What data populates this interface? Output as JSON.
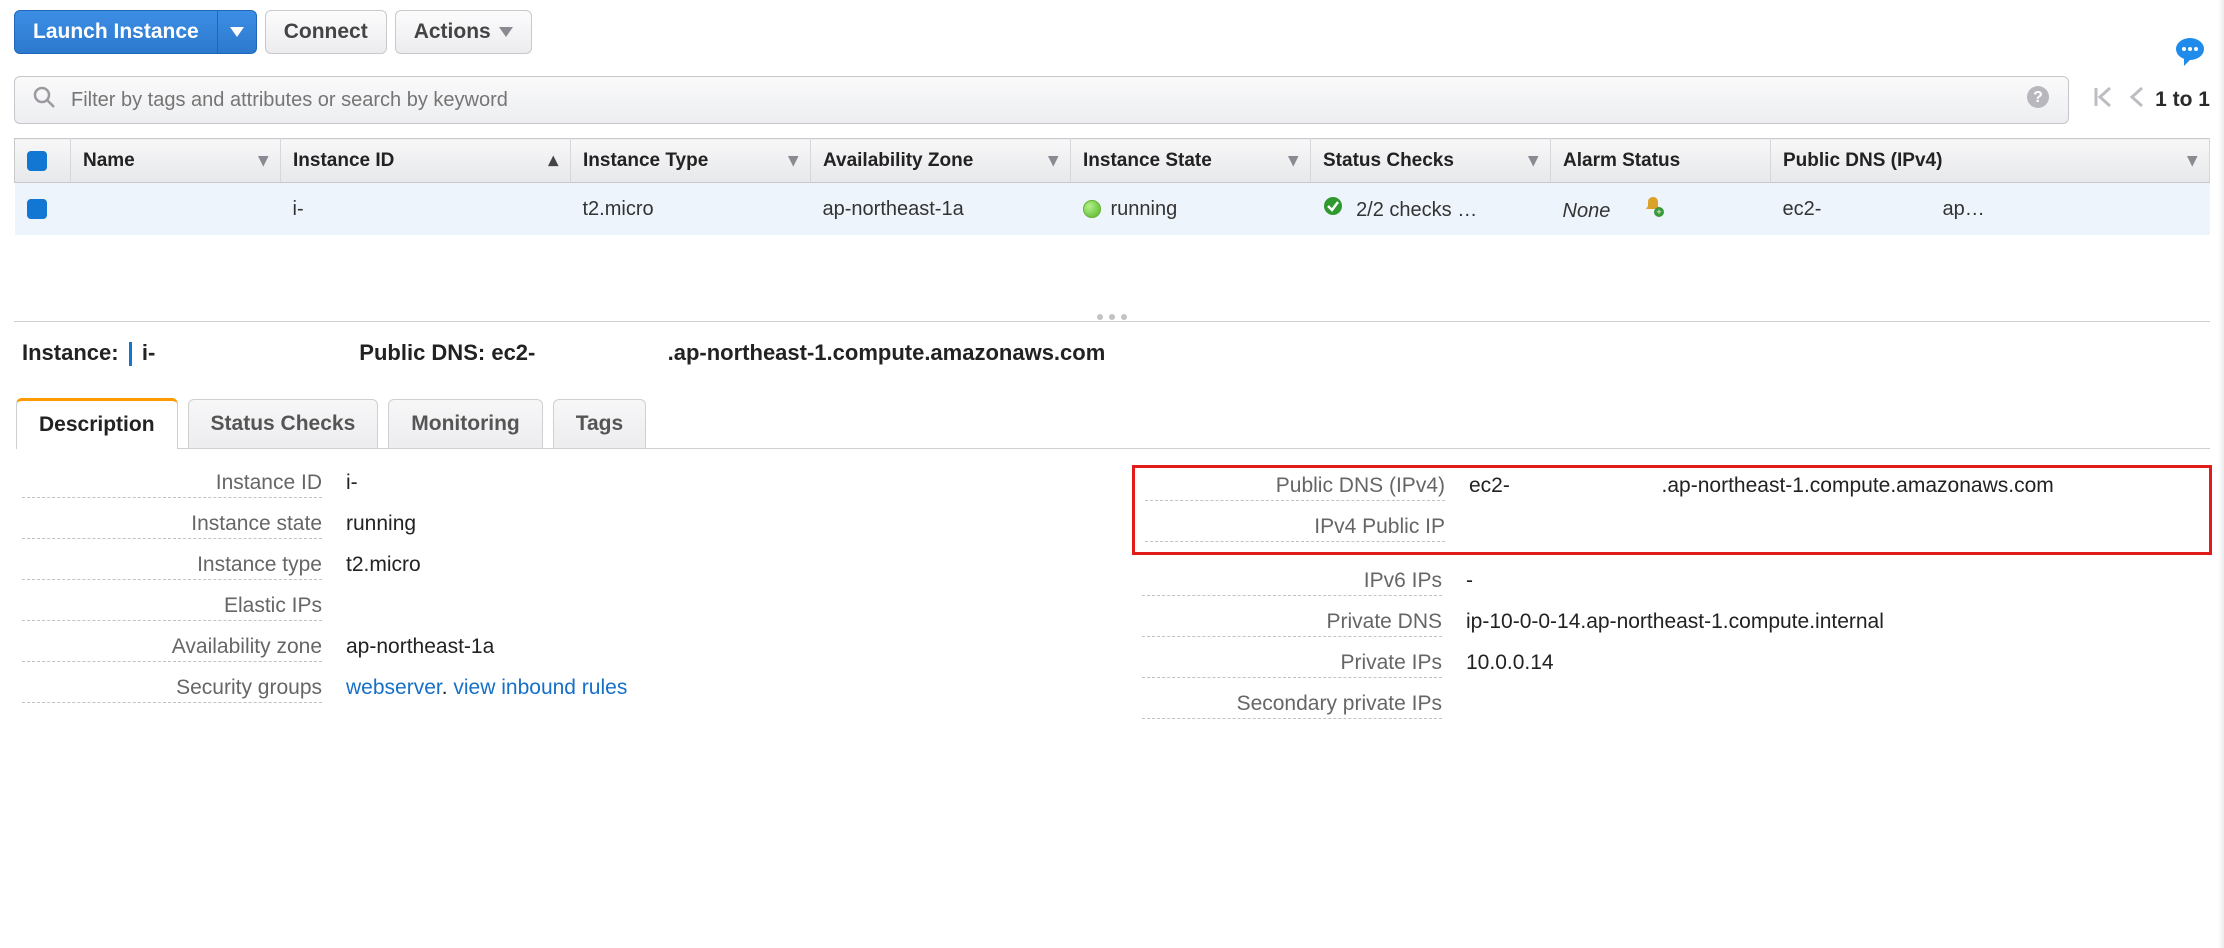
{
  "toolbar": {
    "launch_label": "Launch Instance",
    "connect_label": "Connect",
    "actions_label": "Actions"
  },
  "filter": {
    "placeholder": "Filter by tags and attributes or search by keyword"
  },
  "pager": {
    "range_label": "1 to 1"
  },
  "columns": {
    "name": "Name",
    "instance_id": "Instance ID",
    "instance_type": "Instance Type",
    "az": "Availability Zone",
    "state": "Instance State",
    "status_checks": "Status Checks",
    "alarm_status": "Alarm Status",
    "public_dns": "Public DNS (IPv4)"
  },
  "rows": [
    {
      "name": "",
      "instance_id": "i-",
      "instance_type": "t2.micro",
      "az": "ap-northeast-1a",
      "state": "running",
      "status_checks": "2/2 checks …",
      "alarm_status": "None",
      "public_dns_prefix": "ec2-",
      "public_dns_suffix": "ap…"
    }
  ],
  "detail_header": {
    "instance_label": "Instance:",
    "instance_value": "i-",
    "public_dns_label": "Public DNS:",
    "public_dns_value": "ec2-",
    "public_dns_suffix": ".ap-northeast-1.compute.amazonaws.com"
  },
  "tabs": {
    "description": "Description",
    "status_checks": "Status Checks",
    "monitoring": "Monitoring",
    "tags": "Tags"
  },
  "desc_left": {
    "instance_id": {
      "k": "Instance ID",
      "v": "i-"
    },
    "instance_state": {
      "k": "Instance state",
      "v": "running"
    },
    "instance_type": {
      "k": "Instance type",
      "v": "t2.micro"
    },
    "elastic_ips": {
      "k": "Elastic IPs",
      "v": ""
    },
    "az": {
      "k": "Availability zone",
      "v": "ap-northeast-1a"
    },
    "security_groups": {
      "k": "Security groups",
      "link1": "webserver",
      "sep": ". ",
      "link2": "view inbound rules"
    }
  },
  "desc_right": {
    "public_dns": {
      "k": "Public DNS (IPv4)",
      "v_prefix": "ec2-",
      "v_suffix": ".ap-northeast-1.compute.amazonaws.com"
    },
    "public_ip": {
      "k": "IPv4 Public IP",
      "v": ""
    },
    "ipv6": {
      "k": "IPv6 IPs",
      "v": "-"
    },
    "private_dns": {
      "k": "Private DNS",
      "v": "ip-10-0-0-14.ap-northeast-1.compute.internal"
    },
    "private_ips": {
      "k": "Private IPs",
      "v": "10.0.0.14"
    },
    "secondary_private_ips": {
      "k": "Secondary private IPs",
      "v": ""
    }
  }
}
